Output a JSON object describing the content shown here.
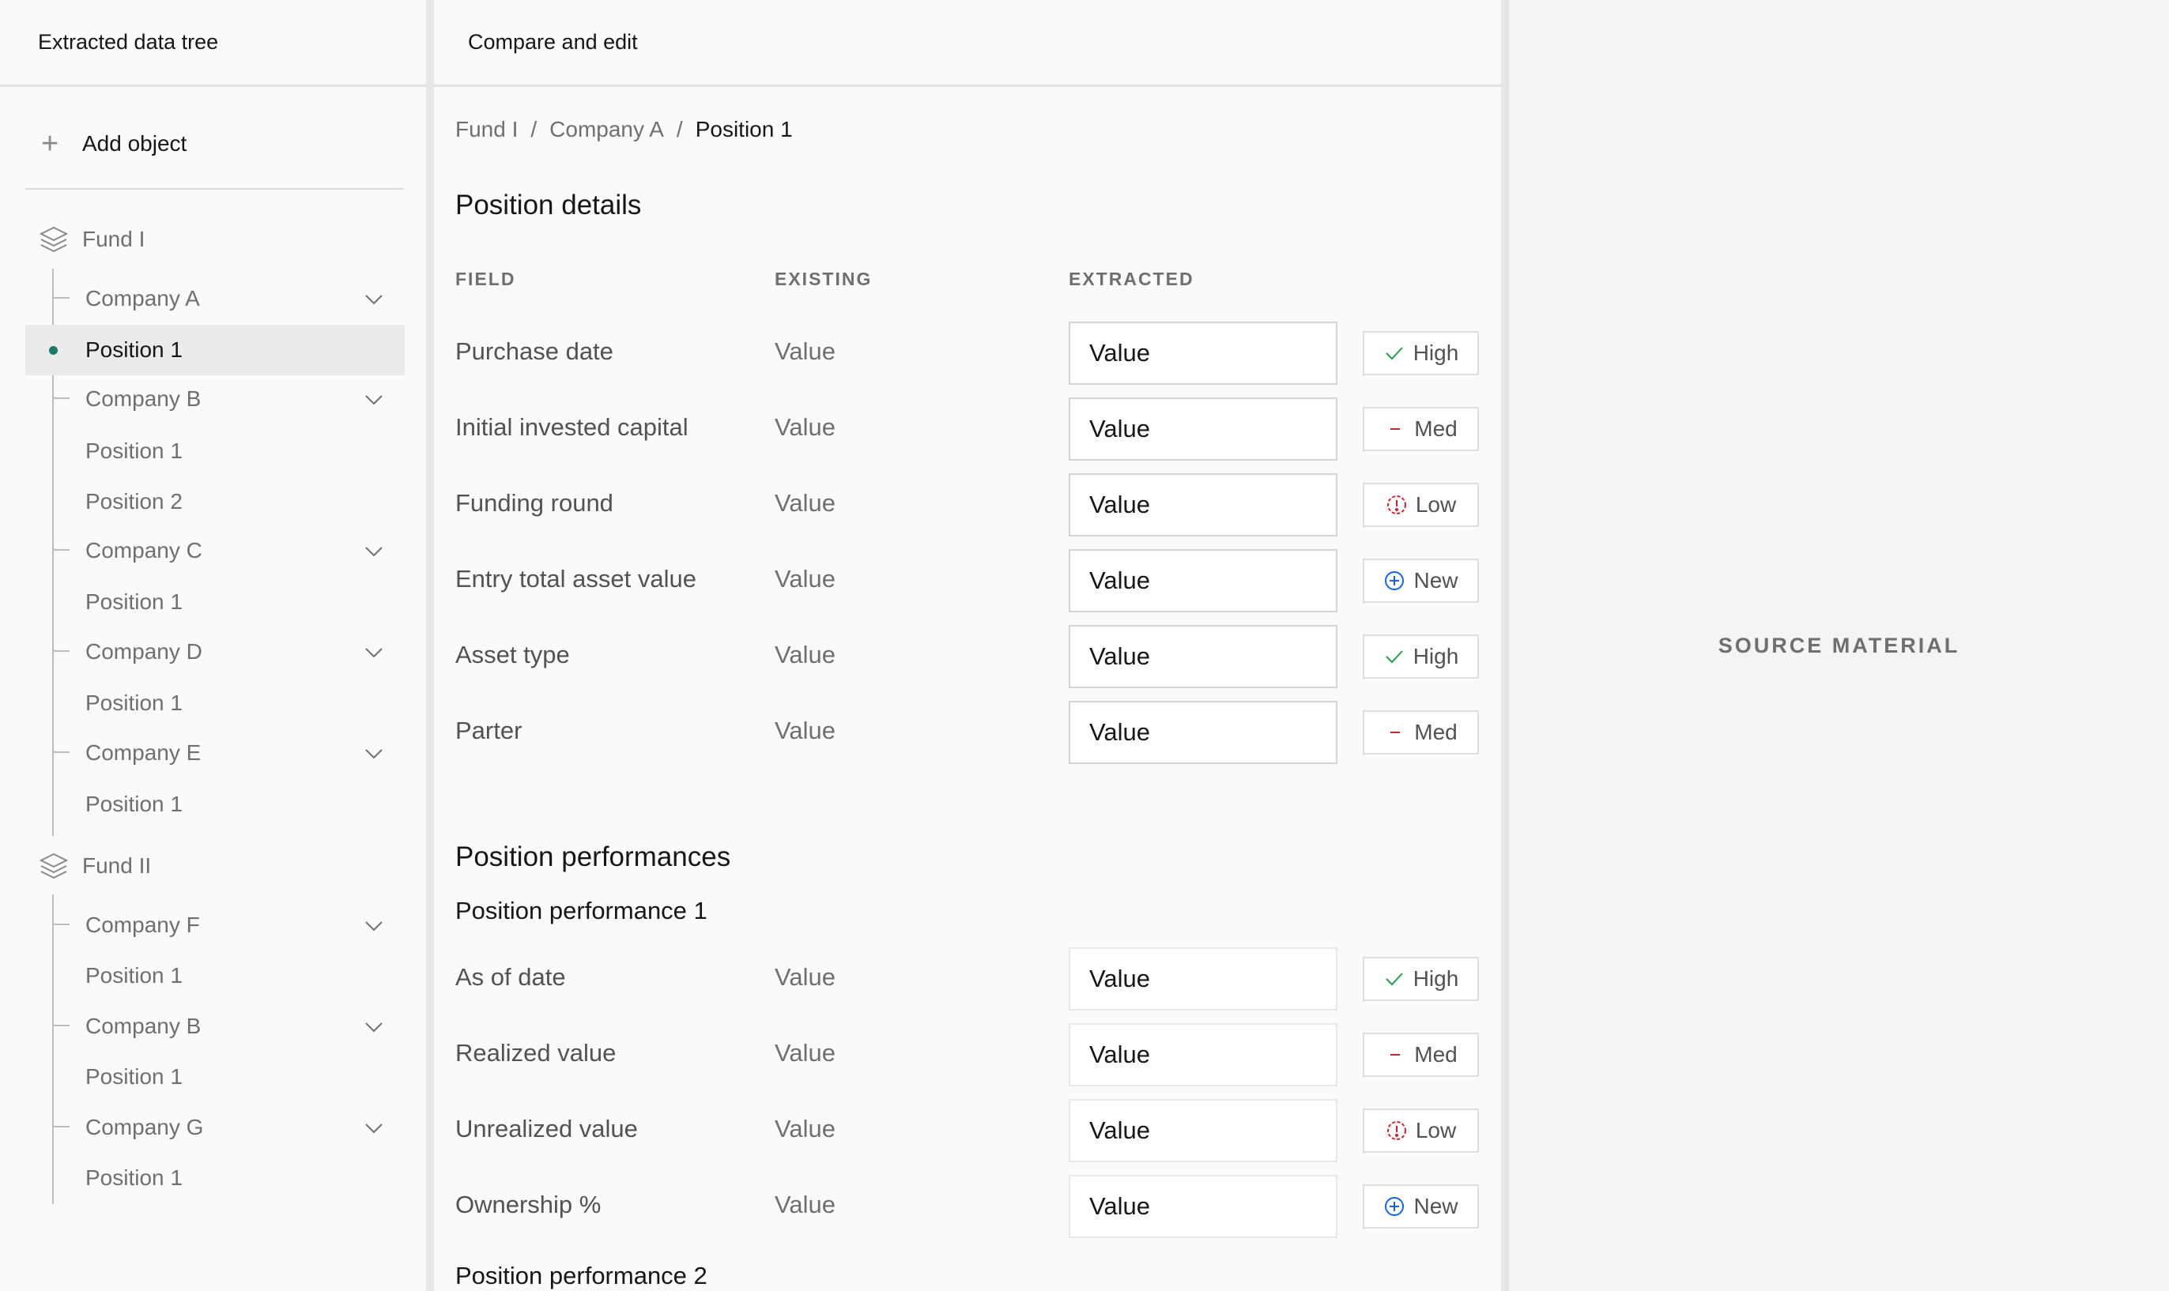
{
  "left_panel": {
    "title": "Extracted data tree",
    "add_object": "Add object",
    "funds": [
      {
        "name": "Fund I",
        "companies": [
          {
            "name": "Company A",
            "positions": [
              "Position 1"
            ]
          },
          {
            "name": "Company B",
            "positions": [
              "Position 1",
              "Position 2"
            ]
          },
          {
            "name": "Company C",
            "positions": [
              "Position 1"
            ]
          },
          {
            "name": "Company D",
            "positions": [
              "Position 1"
            ]
          },
          {
            "name": "Company E",
            "positions": [
              "Position 1"
            ]
          }
        ]
      },
      {
        "name": "Fund II",
        "companies": [
          {
            "name": "Company F",
            "positions": [
              "Position 1"
            ]
          },
          {
            "name": "Company B",
            "positions": [
              "Position 1"
            ]
          },
          {
            "name": "Company G",
            "positions": [
              "Position 1"
            ]
          }
        ]
      }
    ]
  },
  "middle_panel": {
    "title": "Compare and edit",
    "breadcrumb": [
      "Fund I",
      "Company A",
      "Position 1"
    ],
    "breadcrumb_sep": "/",
    "details_title": "Position details",
    "columns": {
      "field": "FIELD",
      "existing": "EXISTING",
      "extracted": "EXTRACTED"
    },
    "details_rows": [
      {
        "field": "Purchase date",
        "existing": "Value",
        "extracted": "Value",
        "confidence": "High"
      },
      {
        "field": "Initial invested capital",
        "existing": "Value",
        "extracted": "Value",
        "confidence": "Med"
      },
      {
        "field": "Funding round",
        "existing": "Value",
        "extracted": "Value",
        "confidence": "Low"
      },
      {
        "field": "Entry total asset value",
        "existing": "Value",
        "extracted": "Value",
        "confidence": "New"
      },
      {
        "field": "Asset type",
        "existing": "Value",
        "extracted": "Value",
        "confidence": "High"
      },
      {
        "field": "Parter",
        "existing": "Value",
        "extracted": "Value",
        "confidence": "Med"
      }
    ],
    "performances_title": "Position performances",
    "performance_1_title": "Position performance 1",
    "performance_rows": [
      {
        "field": "As of date",
        "existing": "Value",
        "extracted": "Value",
        "confidence": "High"
      },
      {
        "field": "Realized value",
        "existing": "Value",
        "extracted": "Value",
        "confidence": "Med"
      },
      {
        "field": "Unrealized value",
        "existing": "Value",
        "extracted": "Value",
        "confidence": "Low"
      },
      {
        "field": "Ownership %",
        "existing": "Value",
        "extracted": "Value",
        "confidence": "New"
      }
    ],
    "performance_2_title": "Position performance 2"
  },
  "right_panel": {
    "label": "SOURCE MATERIAL"
  },
  "colors": {
    "high": "#24a148",
    "med": "#da1e28",
    "low": "#da1e28",
    "new": "#0f62fe",
    "active_dot": "#1a7a6a"
  },
  "icons": {
    "high": "checkmark-icon",
    "med": "minus-icon",
    "low": "warning-circle-icon",
    "new": "add-circle-icon",
    "fund": "layers-icon",
    "company_toggle": "chevron-down-icon",
    "add": "plus-icon"
  }
}
